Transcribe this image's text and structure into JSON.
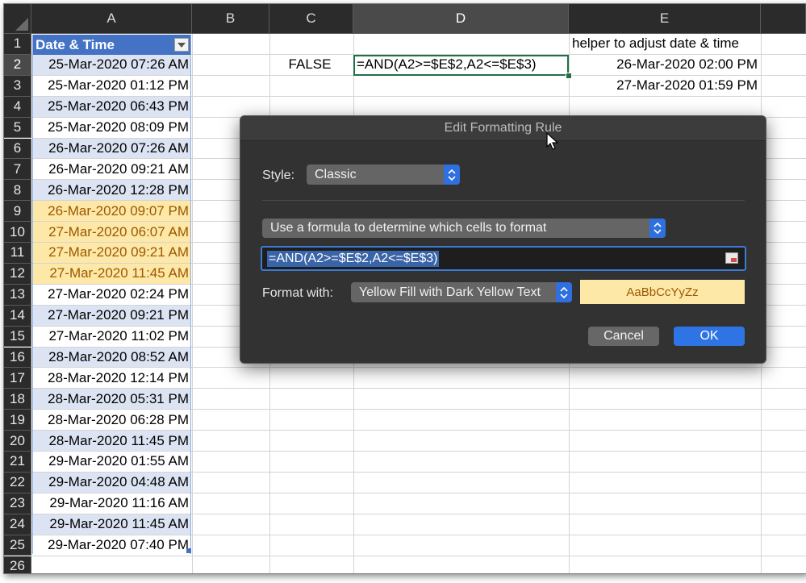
{
  "columns": [
    {
      "label": "A"
    },
    {
      "label": "B"
    },
    {
      "label": "C"
    },
    {
      "label": "D"
    },
    {
      "label": "E"
    }
  ],
  "rows": [
    "1",
    "2",
    "3",
    "4",
    "5",
    "6",
    "7",
    "8",
    "9",
    "10",
    "11",
    "12",
    "13",
    "14",
    "15",
    "16",
    "17",
    "18",
    "19",
    "20",
    "21",
    "22",
    "23",
    "24",
    "25",
    "26"
  ],
  "table_header": "Date & Time",
  "column_a_values": [
    "25-Mar-2020 07:26 AM",
    "25-Mar-2020 01:12 PM",
    "25-Mar-2020 06:43 PM",
    "25-Mar-2020 08:09 PM",
    "26-Mar-2020 07:26 AM",
    "26-Mar-2020 09:21 AM",
    "26-Mar-2020 12:28 PM",
    "26-Mar-2020 09:07 PM",
    "27-Mar-2020 06:07 AM",
    "27-Mar-2020 09:21 AM",
    "27-Mar-2020 11:45 AM",
    "27-Mar-2020 02:24 PM",
    "27-Mar-2020 09:21 PM",
    "27-Mar-2020 11:02 PM",
    "28-Mar-2020 08:52 AM",
    "28-Mar-2020 12:14 PM",
    "28-Mar-2020 05:31 PM",
    "28-Mar-2020 06:28 PM",
    "28-Mar-2020 11:45 PM",
    "29-Mar-2020 01:55 AM",
    "29-Mar-2020 04:48 AM",
    "29-Mar-2020 11:16 AM",
    "29-Mar-2020 11:45 AM",
    "29-Mar-2020 07:40 PM"
  ],
  "highlighted_rows": [
    9,
    10,
    11,
    12
  ],
  "cells": {
    "c2": "FALSE",
    "d2": "=AND(A2>=$E$2,A2<=$E$3)",
    "e1": "helper to adjust date & time",
    "e2": "26-Mar-2020 02:00 PM",
    "e3": "27-Mar-2020 01:59 PM"
  },
  "selected_column": "D",
  "selected_row": "2",
  "dialog": {
    "title": "Edit Formatting Rule",
    "style_label": "Style:",
    "style_value": "Classic",
    "rule_type": "Use a formula to determine which cells to format",
    "formula": "=AND(A2>=$E$2,A2<=$E$3)",
    "format_with_label": "Format with:",
    "format_with_value": "Yellow Fill with Dark Yellow Text",
    "preview_text": "AaBbCcYyZz",
    "cancel_label": "Cancel",
    "ok_label": "OK"
  },
  "colors": {
    "table_header": "#4472c4",
    "band": "#dce4f3",
    "highlight_fill": "#fde8a8",
    "highlight_text": "#9c5700",
    "active_cell_border": "#1e7145",
    "dialog_bg": "#323232",
    "accent": "#2f74e5"
  }
}
